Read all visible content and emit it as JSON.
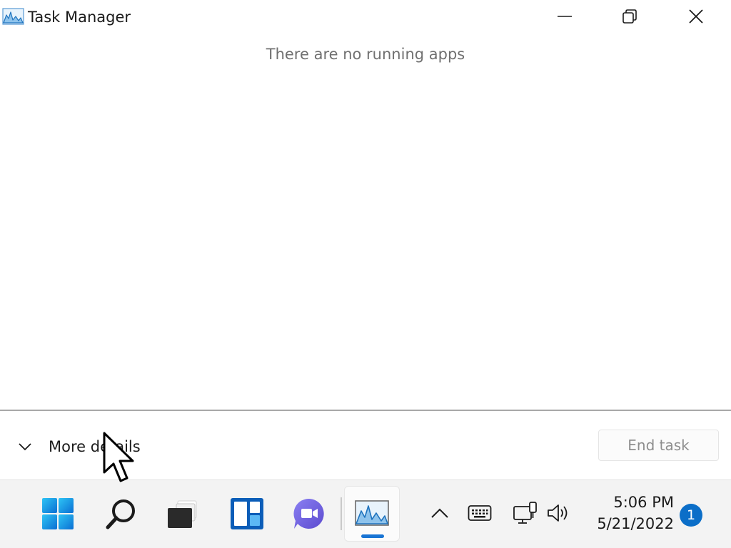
{
  "window": {
    "title": "Task Manager",
    "icon": "task-manager-icon"
  },
  "content": {
    "empty_message": "There are no running apps"
  },
  "footer": {
    "more_details_label": "More details",
    "end_task_label": "End task"
  },
  "taskbar": {
    "apps": [
      {
        "name": "start",
        "icon": "windows-start-icon"
      },
      {
        "name": "search",
        "icon": "search-icon"
      },
      {
        "name": "task-view",
        "icon": "task-view-icon"
      },
      {
        "name": "widgets",
        "icon": "widgets-icon"
      },
      {
        "name": "chat",
        "icon": "teams-chat-icon"
      },
      {
        "name": "task-manager",
        "icon": "task-manager-icon",
        "active": true
      }
    ],
    "tray": {
      "overflow_icon": "chevron-up-icon",
      "keyboard_icon": "keyboard-icon",
      "network_icon": "network-icon",
      "volume_icon": "volume-icon"
    },
    "clock": {
      "time": "5:06 PM",
      "date": "5/21/2022"
    },
    "notification_count": "1"
  },
  "colors": {
    "accent": "#1874d4",
    "notification_badge": "#0b6ec8",
    "muted_text": "#707070"
  }
}
